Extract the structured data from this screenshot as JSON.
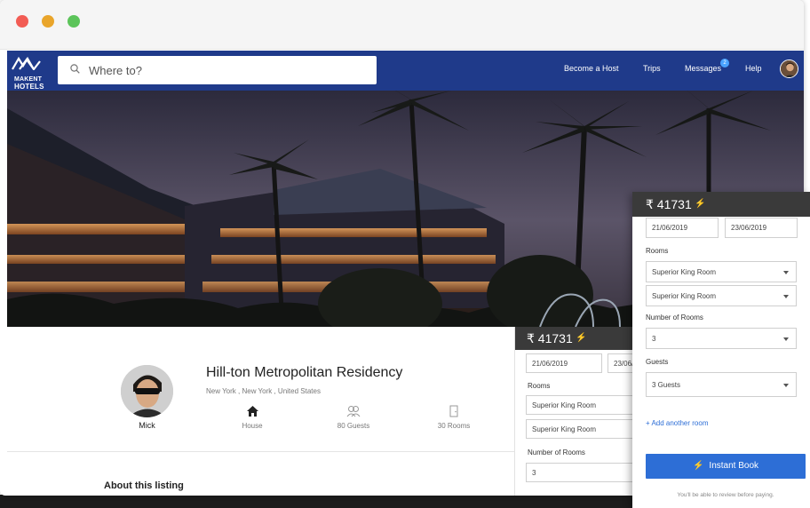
{
  "window": {
    "controls": [
      "close",
      "minimize",
      "maximize"
    ]
  },
  "brand": {
    "line1": "MAKENT",
    "line2": "HOTELS"
  },
  "search": {
    "placeholder": "Where to?"
  },
  "nav": {
    "become_host": "Become a Host",
    "trips": "Trips",
    "messages": "Messages",
    "messages_count": "2",
    "help": "Help"
  },
  "listing": {
    "title": "Hill-ton Metropolitan Residency",
    "location": "New York , New York , United States",
    "host_name": "Mick",
    "amenities": [
      {
        "icon": "house-icon",
        "label": "House"
      },
      {
        "icon": "guests-icon",
        "label": "80 Guests"
      },
      {
        "icon": "door-icon",
        "label": "30 Rooms"
      }
    ],
    "about_heading": "About this listing"
  },
  "booking_back": {
    "price": "₹ 41731",
    "checkin": "21/06/2019",
    "checkout": "23/06/2019",
    "rooms_label": "Rooms",
    "room1": "Superior King Room",
    "room2": "Superior King Room",
    "num_rooms_label": "Number of Rooms",
    "num_rooms": "3"
  },
  "booking_front": {
    "price": "₹ 41731",
    "checkin": "21/06/2019",
    "checkout": "23/06/2019",
    "rooms_label": "Rooms",
    "room1": "Superior King Room",
    "room2": "Superior King Room",
    "num_rooms_label": "Number of Rooms",
    "num_rooms": "3",
    "guests_label": "Guests",
    "guests": "3 Guests",
    "add_room": "+ Add another room",
    "instant_book": "Instant Book",
    "note": "You'll be able to review before paying."
  },
  "colors": {
    "nav": "#1f3a8a",
    "button": "#2d6ed6",
    "price_bar": "#3a3a3a",
    "bolt": "#f5b800"
  }
}
